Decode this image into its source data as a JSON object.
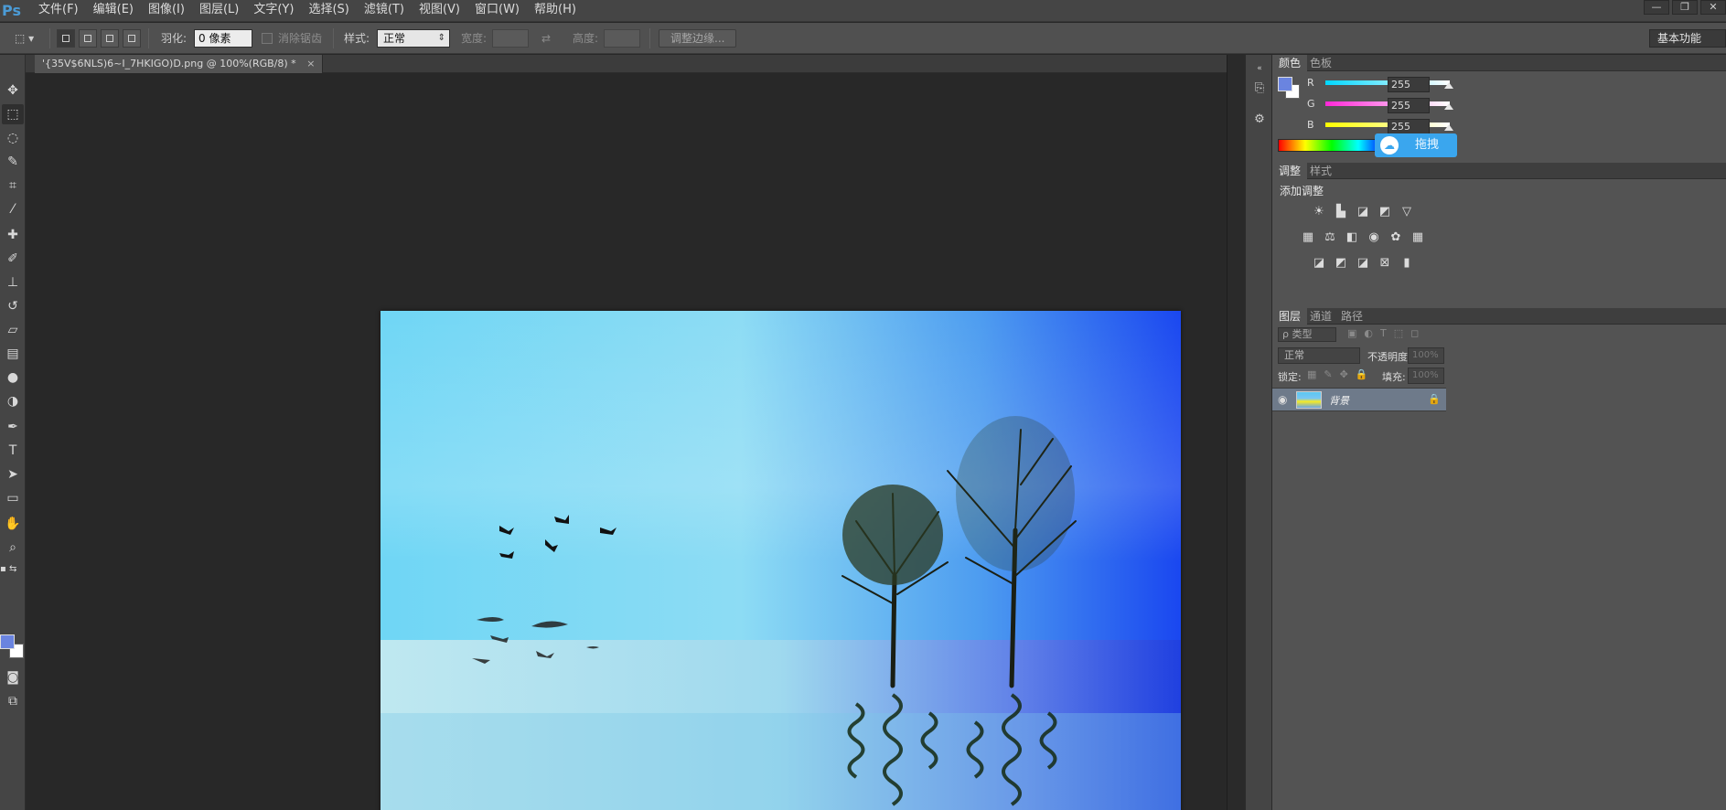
{
  "app": {
    "logo": "Ps"
  },
  "menu": [
    "文件(F)",
    "编辑(E)",
    "图像(I)",
    "图层(L)",
    "文字(Y)",
    "选择(S)",
    "滤镜(T)",
    "视图(V)",
    "窗口(W)",
    "帮助(H)"
  ],
  "window_controls": {
    "minimize": "—",
    "restore": "❐",
    "close": "✕"
  },
  "options": {
    "feather_label": "羽化:",
    "feather_value": "0 像素",
    "antialias_label": "消除锯齿",
    "style_label": "样式:",
    "style_value": "正常",
    "width_label": "宽度:",
    "height_label": "高度:",
    "refine_edge": "调整边缘...",
    "workspace": "基本功能"
  },
  "document": {
    "tab_title": "'{35V$6NLS)6~I_7HKIGO)D.png @ 100%(RGB/8) *",
    "close": "×"
  },
  "color_panel": {
    "tabs": [
      "颜色",
      "色板"
    ],
    "channels": [
      {
        "label": "R",
        "value": "255",
        "color": "#00d7ff"
      },
      {
        "label": "G",
        "value": "255",
        "color": "#ff28d7"
      },
      {
        "label": "B",
        "value": "255",
        "color": "#ffff00"
      }
    ],
    "fg_color": "#6a84e0",
    "bg_color": "#ffffff",
    "overlay_text": "拖拽"
  },
  "adjust_panel": {
    "tabs": [
      "调整",
      "样式"
    ],
    "title": "添加调整",
    "row1": [
      "brightness-icon",
      "levels-icon",
      "curves-icon",
      "exposure-icon",
      "vibrance-icon"
    ],
    "row2": [
      "hue-saturation-icon",
      "color-balance-icon",
      "black-white-icon",
      "photo-filter-icon",
      "channel-mixer-icon",
      "color-lookup-icon"
    ],
    "row3": [
      "invert-icon",
      "posterize-icon",
      "threshold-icon",
      "selective-color-icon",
      "gradient-map-icon"
    ]
  },
  "layers_panel": {
    "tabs": [
      "图层",
      "通道",
      "路径"
    ],
    "filter_label": "ρ 类型",
    "blend_mode": "正常",
    "opacity_label": "不透明度:",
    "opacity_value": "100%",
    "lock_label": "锁定:",
    "fill_label": "填充:",
    "fill_value": "100%",
    "layers": [
      {
        "name": "背景",
        "locked": true,
        "visible": true
      }
    ]
  }
}
